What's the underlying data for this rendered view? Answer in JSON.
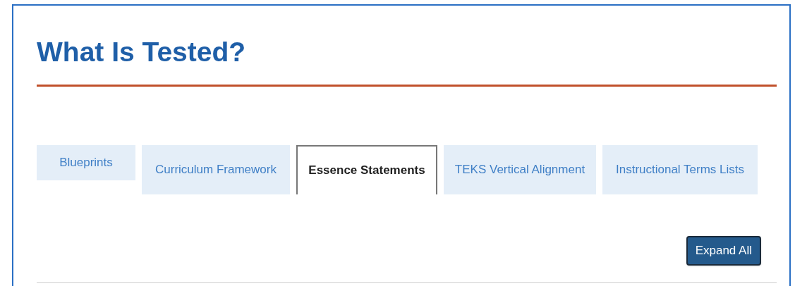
{
  "title": "What Is Tested?",
  "tabs": [
    {
      "label": "Blueprints",
      "selected": false
    },
    {
      "label": "Curriculum Framework",
      "selected": false
    },
    {
      "label": "Essence Statements",
      "selected": true
    },
    {
      "label": "TEKS Vertical Alignment",
      "selected": false
    },
    {
      "label": "Instructional Terms Lists",
      "selected": false
    }
  ],
  "buttons": [
    {
      "label": "Expand All"
    }
  ]
}
